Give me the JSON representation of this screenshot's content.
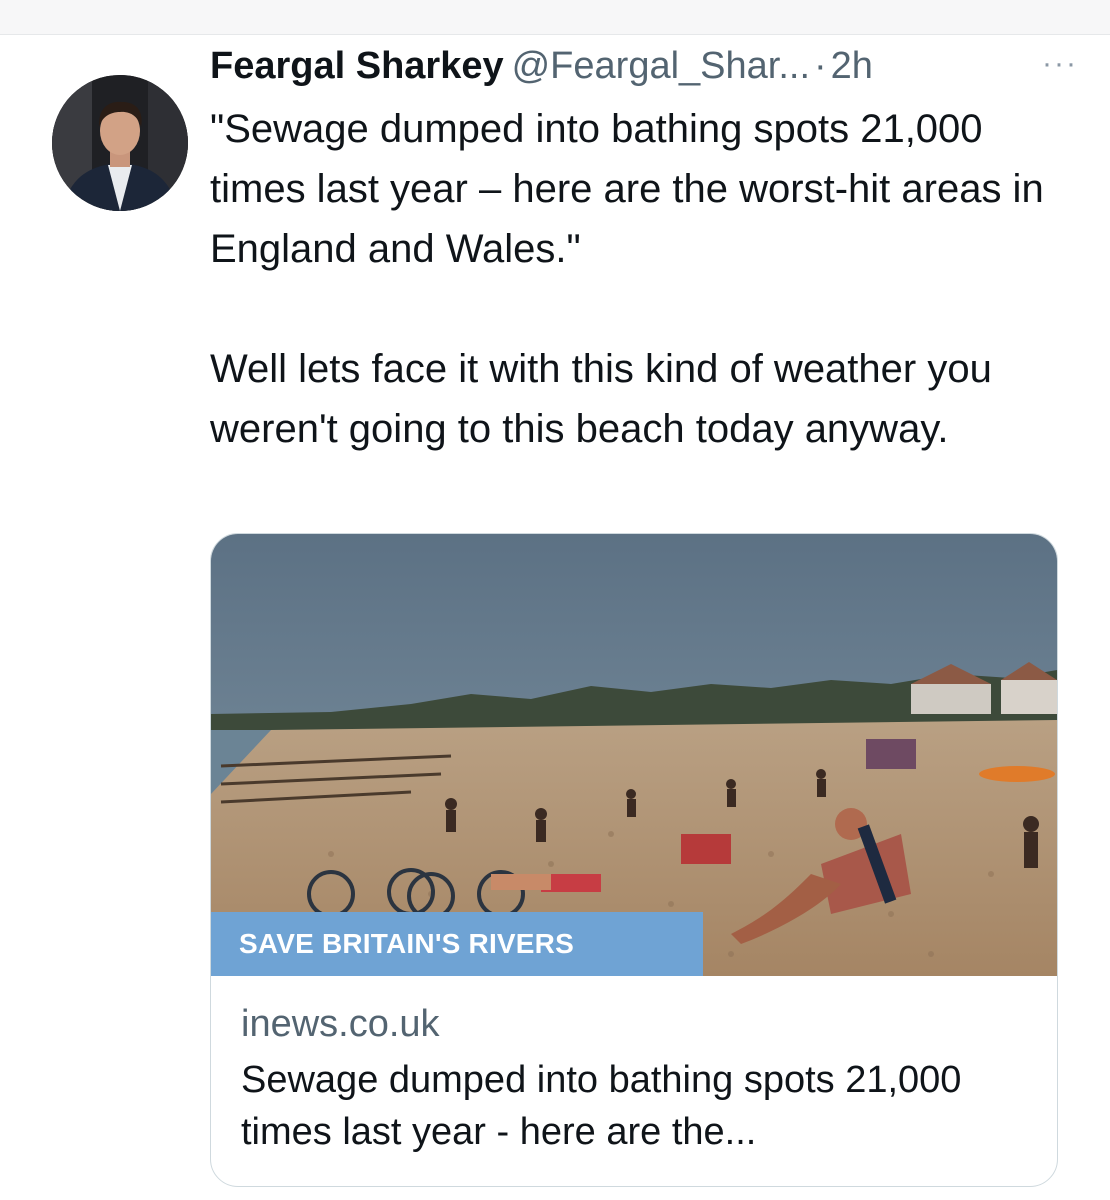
{
  "tweet": {
    "author_name": "Feargal Sharkey",
    "author_handle": "@Feargal_Shar...",
    "separator": "·",
    "time": "2h",
    "more_label": "···",
    "paragraph_1": "\"Sewage dumped into bathing spots 21,000 times last year – here are the worst-hit areas in England and Wales.\"",
    "paragraph_2": "Well lets face it with this kind of weather you weren't going to this beach today anyway."
  },
  "link_card": {
    "image_tag": "SAVE BRITAIN'S RIVERS",
    "domain": "inews.co.uk",
    "title": "Sewage dumped into bathing spots 21,000 times last year - here are the..."
  },
  "colors": {
    "tag_background": "#6fa3d4",
    "secondary_text": "#536471",
    "card_border": "#cfd9de"
  },
  "icons": {
    "more": "more-horizontal-icon"
  }
}
